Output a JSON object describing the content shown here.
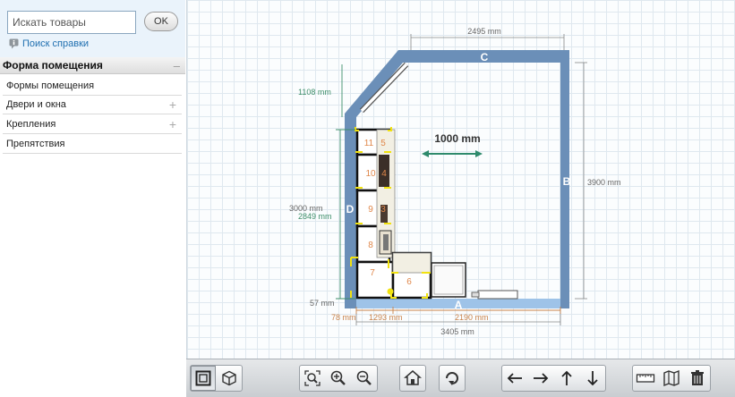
{
  "sidebar": {
    "search": {
      "placeholder": "Искать товары",
      "button": "OK"
    },
    "help_link": "Поиск справки",
    "section_title": "Форма помещения",
    "section_toggle": "–",
    "items": [
      {
        "label": "Формы помещения",
        "expand": ""
      },
      {
        "label": "Двери и окна",
        "expand": "+"
      },
      {
        "label": "Крепления",
        "expand": "+"
      },
      {
        "label": "Препятствия",
        "expand": ""
      }
    ]
  },
  "plan": {
    "walls": {
      "top": "C",
      "right": "B",
      "left": "D",
      "bottom": "A"
    },
    "dimensions": {
      "top_width": "2495 mm",
      "right_height": "3900 mm",
      "corner_height": "1108 mm",
      "left_height": "3000 mm",
      "left_inner": "2849 mm",
      "bottom_offset": "57 mm",
      "bottom_left": "78 mm",
      "bottom_mid": "1293 mm",
      "bottom_right": "2190 mm",
      "total_width": "3405 mm",
      "scale": "1000 mm"
    },
    "cabinets": [
      "11",
      "5",
      "10",
      "4",
      "9",
      "3",
      "8",
      "7",
      "6"
    ]
  },
  "toolbar": {
    "tools": [
      "view-2d-icon",
      "view-3d-icon",
      "zoom-fit-icon",
      "zoom-in-icon",
      "zoom-out-icon",
      "home-icon",
      "rotate-icon",
      "arrow-left-icon",
      "arrow-right-icon",
      "arrow-up-icon",
      "arrow-down-icon",
      "ruler-icon",
      "map-icon",
      "trash-icon"
    ]
  },
  "colors": {
    "wall": "#6b8fb8",
    "dim_green": "#3f8f6a",
    "dim_orange": "#c8824a",
    "cabinet_num": "#e0874a",
    "highlight": "#f1e20f"
  }
}
